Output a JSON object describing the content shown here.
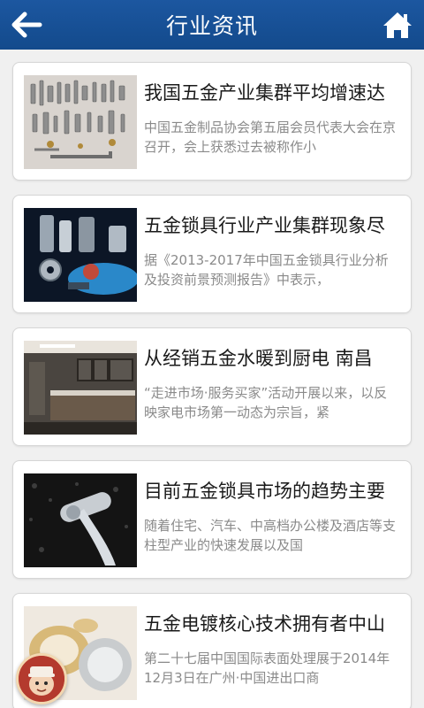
{
  "header": {
    "title": "行业资讯",
    "back_icon": "back-arrow-icon",
    "home_icon": "home-icon"
  },
  "articles": [
    {
      "title": "我国五金产业集群平均增速达",
      "summary": "中国五金制品协会第五届会员代表大会在京召开，会上获悉过去被称作小",
      "thumb": "hardware-bolts-image"
    },
    {
      "title": "五金锁具行业产业集群现象尽",
      "summary": "据《2013-2017年中国五金锁具行业分析及投资前景预测报告》中表示，",
      "thumb": "metal-parts-image"
    },
    {
      "title": "从经销五金水暖到厨电 南昌",
      "summary": "“走进市场·服务买家”活动开展以来，以反映家电市场第一动态为宗旨，紧",
      "thumb": "kitchen-image"
    },
    {
      "title": "目前五金锁具市场的趋势主要",
      "summary": "随着住宅、汽车、中高档办公楼及酒店等支柱型产业的快速发展以及国",
      "thumb": "door-handle-image"
    },
    {
      "title": "五金电镀核心技术拥有者中山",
      "summary": "第二十七届中国国际表面处理展于2014年12月3日在广州·中国进出口商",
      "thumb": "plated-rings-image"
    }
  ],
  "colors": {
    "header_bg": "#1c57a0",
    "page_bg": "#f0f0f0",
    "summary_text": "#8a8a8a"
  }
}
